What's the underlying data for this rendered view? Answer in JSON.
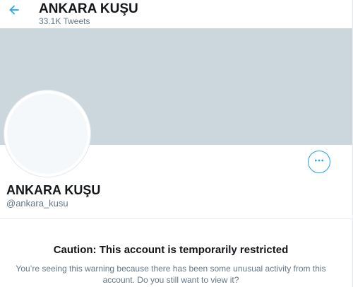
{
  "header": {
    "title": "ANKARA KUŞU",
    "tweet_count": "33.1K Tweets",
    "back_icon": "arrow-left-icon"
  },
  "profile": {
    "display_name": "ANKARA KUŞU",
    "handle": "@ankara_kusu",
    "more_icon": "more-horizontal-icon"
  },
  "warning": {
    "title": "Caution: This account is temporarily restricted",
    "message": "You’re seeing this warning because there has been some unusual activity from this account. Do you still want to view it?"
  },
  "colors": {
    "accent": "#1da1f2",
    "banner": "#ccd6dd",
    "secondary_text": "#657786",
    "primary_text": "#14171a"
  }
}
